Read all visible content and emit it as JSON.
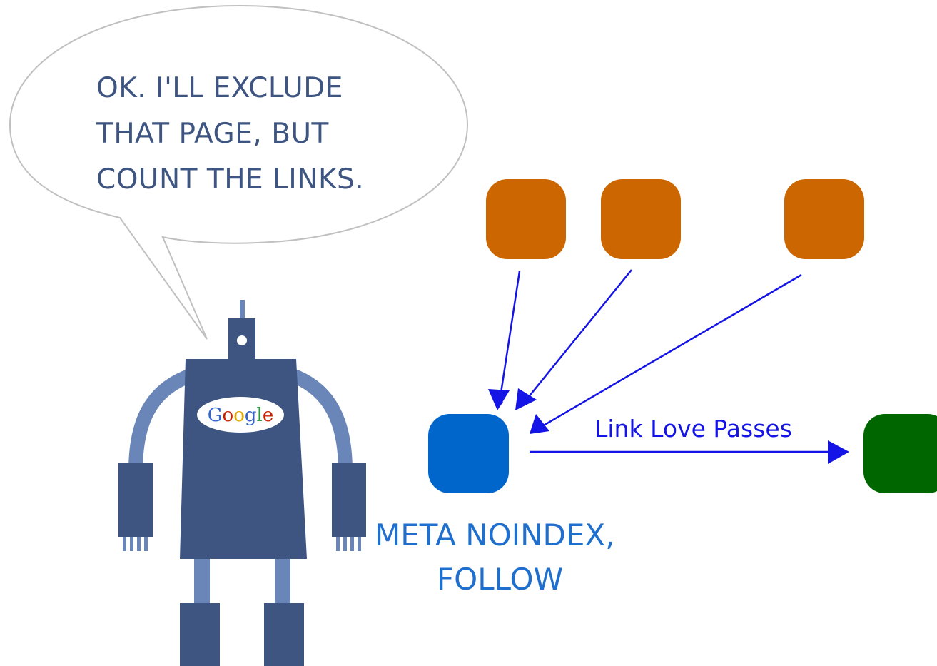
{
  "speech_bubble": {
    "lines": [
      "OK. I'LL EXCLUDE",
      "THAT PAGE, BUT",
      "COUNT THE LINKS."
    ]
  },
  "robot": {
    "badge_text": "Google",
    "badge_letter_colors": [
      "#3366cc",
      "#cc2200",
      "#e6a800",
      "#3366cc",
      "#2a9d3a",
      "#cc2200"
    ],
    "icon": "robot-icon"
  },
  "diagram": {
    "edge_label": "Link Love Passes",
    "caption_lines": [
      "META NOINDEX,",
      "FOLLOW"
    ]
  },
  "colors": {
    "source_node": "#cc6600",
    "center_node": "#0066cc",
    "target_node": "#006600",
    "arrow": "#1414e6",
    "robot_body": "#3d5580",
    "robot_limbs": "#6a86b8",
    "bubble_stroke": "#c0c0c0",
    "bubble_text": "#3d5580",
    "caption": "#1f6fcf"
  }
}
